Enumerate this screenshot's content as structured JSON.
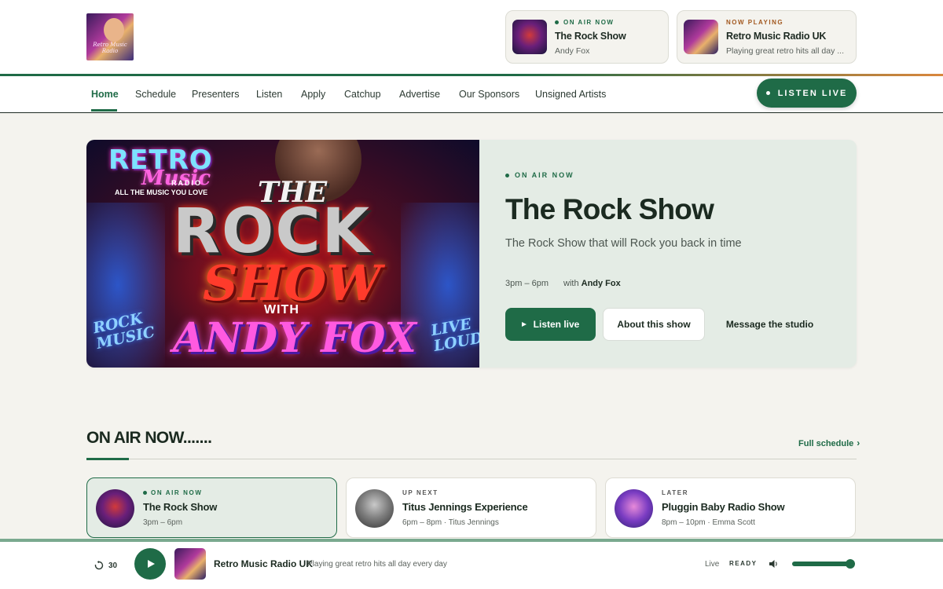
{
  "header": {
    "logo_text": "Retro Music Radio",
    "on_air_card": {
      "kicker": "ON AIR NOW",
      "title": "The Rock Show",
      "subtitle": "Andy Fox"
    },
    "now_playing_card": {
      "kicker": "NOW PLAYING",
      "title": "Retro Music Radio UK",
      "subtitle": "Playing great retro hits all day ..."
    }
  },
  "nav": {
    "items": [
      {
        "label": "Home",
        "active": true
      },
      {
        "label": "Schedule"
      },
      {
        "label": "Presenters"
      },
      {
        "label": "Listen"
      },
      {
        "label": "Apply"
      },
      {
        "label": "Catchup"
      },
      {
        "label": "Advertise"
      },
      {
        "label": "Our Sponsors"
      },
      {
        "label": "Unsigned Artists"
      }
    ],
    "listen_live": "LISTEN  LIVE"
  },
  "hero": {
    "art": {
      "retro": "RETRO",
      "music": "Music",
      "radio": "RADIO",
      "tagline": "ALL THE MUSIC YOU LOVE",
      "the": "THE",
      "rock": "ROCK",
      "show": "SHOW",
      "with": "WITH",
      "andy": "ANDY FOX",
      "rock_music": "ROCK MUSIC",
      "live_loud": "LIVE LOUD"
    },
    "kicker": "ON AIR NOW",
    "title": "The Rock Show",
    "description": "The Rock Show that will Rock you back in time",
    "time": "3pm – 6pm",
    "with_label": "with",
    "presenter": "Andy Fox",
    "buttons": {
      "listen": "Listen live",
      "about": "About this show",
      "message": "Message the studio"
    }
  },
  "on_air_section": {
    "title": "ON AIR NOW.......",
    "full_schedule": "Full schedule",
    "slots": [
      {
        "kicker": "ON AIR NOW",
        "title": "The Rock Show",
        "meta": "3pm – 6pm"
      },
      {
        "kicker": "UP NEXT",
        "title": "Titus Jennings Experience",
        "meta": "6pm – 8pm · Titus Jennings"
      },
      {
        "kicker": "LATER",
        "title": "Pluggin Baby Radio Show",
        "meta": "8pm – 10pm · Emma Scott"
      }
    ]
  },
  "player": {
    "replay": "30",
    "station": "Retro Music Radio UK",
    "subtitle": "Playing great retro hits all day every day",
    "live": "Live",
    "status": "READY",
    "volume": 0.92
  },
  "colors": {
    "accent": "#1f6b47",
    "accent_orange": "#d9873d",
    "page_bg": "#f4f3ee",
    "hero_bg": "#e4ece5"
  },
  "icons": {
    "play": "play-icon",
    "replay": "replay-30-icon",
    "volume": "speaker-icon",
    "chevron": "chevron-right-icon"
  }
}
